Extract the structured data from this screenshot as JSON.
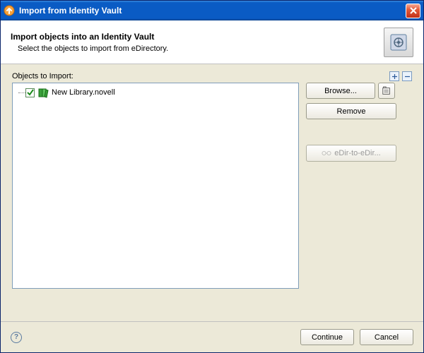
{
  "window": {
    "title": "Import from Identity Vault"
  },
  "header": {
    "title": "Import objects into an Identity Vault",
    "subtitle": "Select the objects to import from eDirectory."
  },
  "objects": {
    "label": "Objects to Import:",
    "items": [
      {
        "label": "New Library.novell",
        "checked": true,
        "icon": "library-icon"
      }
    ]
  },
  "buttons": {
    "browse": "Browse...",
    "remove": "Remove",
    "edir": "eDir-to-eDir...",
    "continue": "Continue",
    "cancel": "Cancel"
  }
}
